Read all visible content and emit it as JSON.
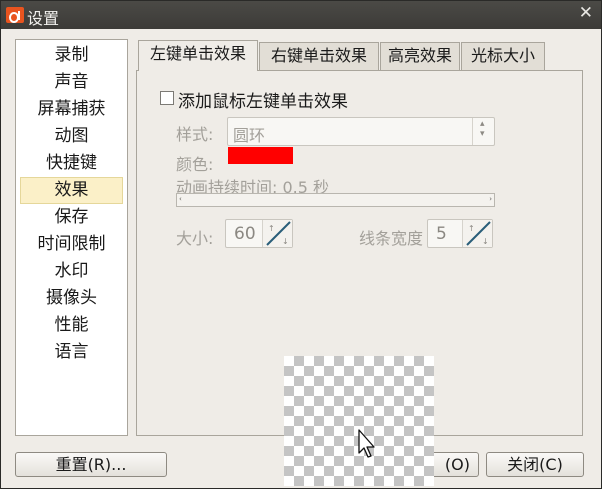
{
  "window": {
    "title": "设置",
    "close_glyph": "✕"
  },
  "sidebar": {
    "items": [
      {
        "label": "录制"
      },
      {
        "label": "声音"
      },
      {
        "label": "屏幕捕获"
      },
      {
        "label": "动图"
      },
      {
        "label": "快捷键"
      },
      {
        "label": "效果",
        "selected": true
      },
      {
        "label": "保存"
      },
      {
        "label": "时间限制"
      },
      {
        "label": "水印"
      },
      {
        "label": "摄像头"
      },
      {
        "label": "性能"
      },
      {
        "label": "语言"
      }
    ]
  },
  "tabs": [
    {
      "label": "左键单击效果",
      "active": true
    },
    {
      "label": "右键单击效果"
    },
    {
      "label": "高亮效果"
    },
    {
      "label": "光标大小"
    }
  ],
  "panel": {
    "enable_checkbox": {
      "label": "添加鼠标左键单击效果",
      "checked": false
    },
    "style": {
      "label": "样式:",
      "value": "圆环"
    },
    "color": {
      "label": "颜色:",
      "value": "#ff0000"
    },
    "duration": {
      "label": "动画持续时间: 0.5 秒",
      "slider_left": "‹",
      "slider_right": "›"
    },
    "size": {
      "label": "大小:",
      "value": "60"
    },
    "line_width": {
      "label": "线条宽度",
      "value": "5"
    }
  },
  "footer": {
    "reset_label": "重置(R)...",
    "ok_label": "(O)",
    "close_label": "关闭(C)"
  },
  "icons": {
    "app": "app-logo-icon",
    "close": "close-icon",
    "cursor": "mouse-pointer-icon"
  }
}
